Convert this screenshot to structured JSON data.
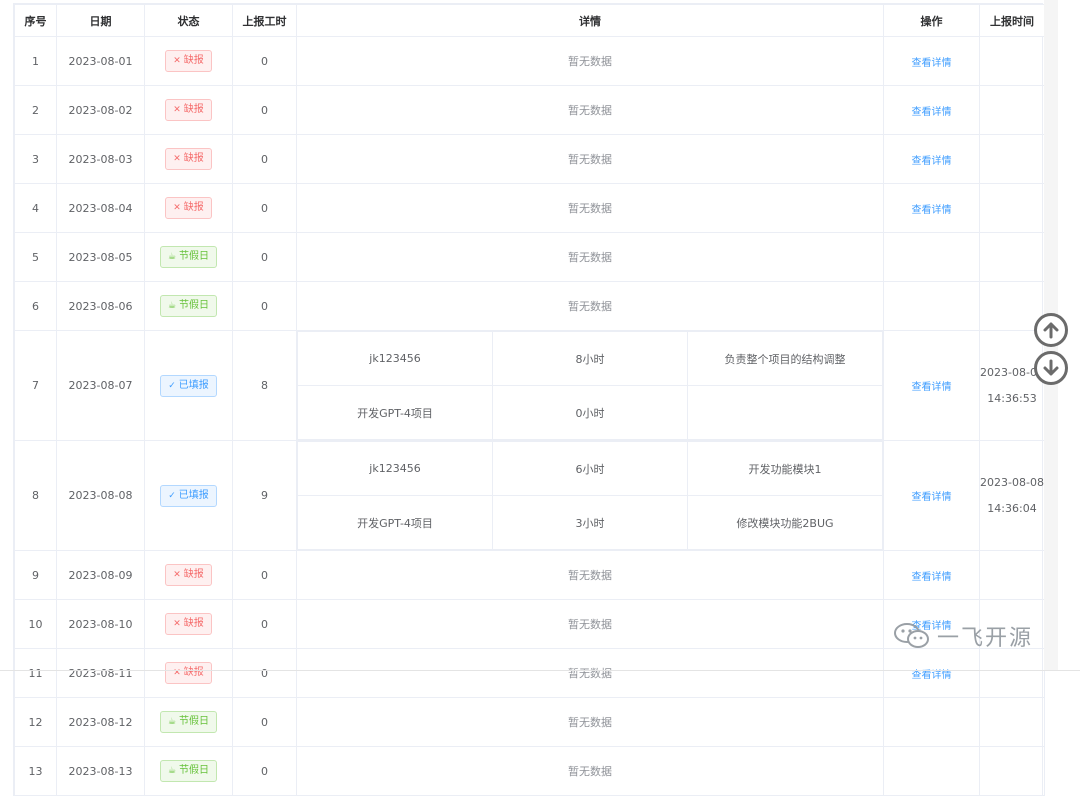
{
  "columns": {
    "index": "序号",
    "date": "日期",
    "status": "状态",
    "hours": "上报工时",
    "detail": "详情",
    "action": "操作",
    "report_time": "上报时间"
  },
  "no_data_text": "暂无数据",
  "action_label": "查看详情",
  "status_labels": {
    "missing": "缺报",
    "holiday": "节假日",
    "filled": "已填报"
  },
  "rows": [
    {
      "index": "1",
      "date": "2023-08-01",
      "status": "缺报",
      "hours": "0"
    },
    {
      "index": "2",
      "date": "2023-08-02",
      "status": "缺报",
      "hours": "0"
    },
    {
      "index": "3",
      "date": "2023-08-03",
      "status": "缺报",
      "hours": "0"
    },
    {
      "index": "4",
      "date": "2023-08-04",
      "status": "缺报",
      "hours": "0"
    },
    {
      "index": "5",
      "date": "2023-08-05",
      "status": "节假日",
      "hours": "0"
    },
    {
      "index": "6",
      "date": "2023-08-06",
      "status": "节假日",
      "hours": "0"
    },
    {
      "index": "7",
      "date": "2023-08-07",
      "status": "已填报",
      "hours": "8",
      "details": [
        {
          "project": "jk123456",
          "hours": "8小时",
          "content": "负责整个项目的结构调整"
        },
        {
          "project": "开发GPT-4项目",
          "hours": "0小时",
          "content": ""
        }
      ],
      "report_date": "2023-08-08",
      "report_clock": "14:36:53"
    },
    {
      "index": "8",
      "date": "2023-08-08",
      "status": "已填报",
      "hours": "9",
      "details": [
        {
          "project": "jk123456",
          "hours": "6小时",
          "content": "开发功能模块1"
        },
        {
          "project": "开发GPT-4项目",
          "hours": "3小时",
          "content": "修改模块功能2BUG"
        }
      ],
      "report_date": "2023-08-08",
      "report_clock": "14:36:04"
    },
    {
      "index": "9",
      "date": "2023-08-09",
      "status": "缺报",
      "hours": "0"
    },
    {
      "index": "10",
      "date": "2023-08-10",
      "status": "缺报",
      "hours": "0"
    },
    {
      "index": "11",
      "date": "2023-08-11",
      "status": "缺报",
      "hours": "0"
    },
    {
      "index": "12",
      "date": "2023-08-12",
      "status": "节假日",
      "hours": "0"
    },
    {
      "index": "13",
      "date": "2023-08-13",
      "status": "节假日",
      "hours": "0"
    }
  ],
  "watermark": "一飞开源",
  "colors": {
    "link": "#409eff",
    "danger": "#f56c6c",
    "success": "#67c23a",
    "primary": "#409eff"
  },
  "icons": {
    "missing": "close-icon",
    "holiday": "coffee-icon",
    "filled": "check-icon",
    "scroll_up": "arrow-up-circle-icon",
    "scroll_down": "arrow-down-circle-icon",
    "watermark": "wechat-icon"
  }
}
